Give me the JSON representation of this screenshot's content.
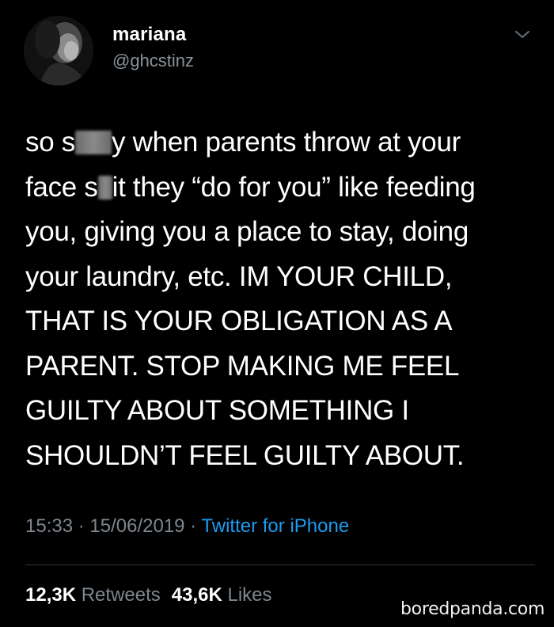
{
  "user": {
    "display_name": "mariana",
    "handle": "@ghcstinz"
  },
  "tweet": {
    "lines": [
      {
        "a": "so s",
        "b": "y when parents throw at your"
      },
      {
        "a": "face s",
        "b": "it they “do for you” like feeding"
      },
      {
        "text": "you, giving you a place to stay, doing"
      },
      {
        "text": "your laundry, etc. IM YOUR CHILD,"
      },
      {
        "text": "THAT IS YOUR OBLIGATION AS A"
      },
      {
        "text": "PARENT. STOP MAKING ME FEEL"
      },
      {
        "text": "GUILTY ABOUT SOMETHING I"
      },
      {
        "text": "SHOULDN’T FEEL GUILTY ABOUT."
      }
    ]
  },
  "meta": {
    "time": "15:33",
    "separator": " · ",
    "date": "15/06/2019",
    "source": "Twitter for iPhone"
  },
  "stats": {
    "retweets_count": "12,3K",
    "retweets_label": "Retweets",
    "likes_count": "43,6K",
    "likes_label": "Likes"
  },
  "watermark": "boredpanda.com",
  "icons": {
    "more": "chevron-down-icon",
    "avatar": "avatar"
  },
  "colors": {
    "background": "#000000",
    "text": "#ffffff",
    "secondary": "#7d868e",
    "link": "#1d9bf0"
  }
}
